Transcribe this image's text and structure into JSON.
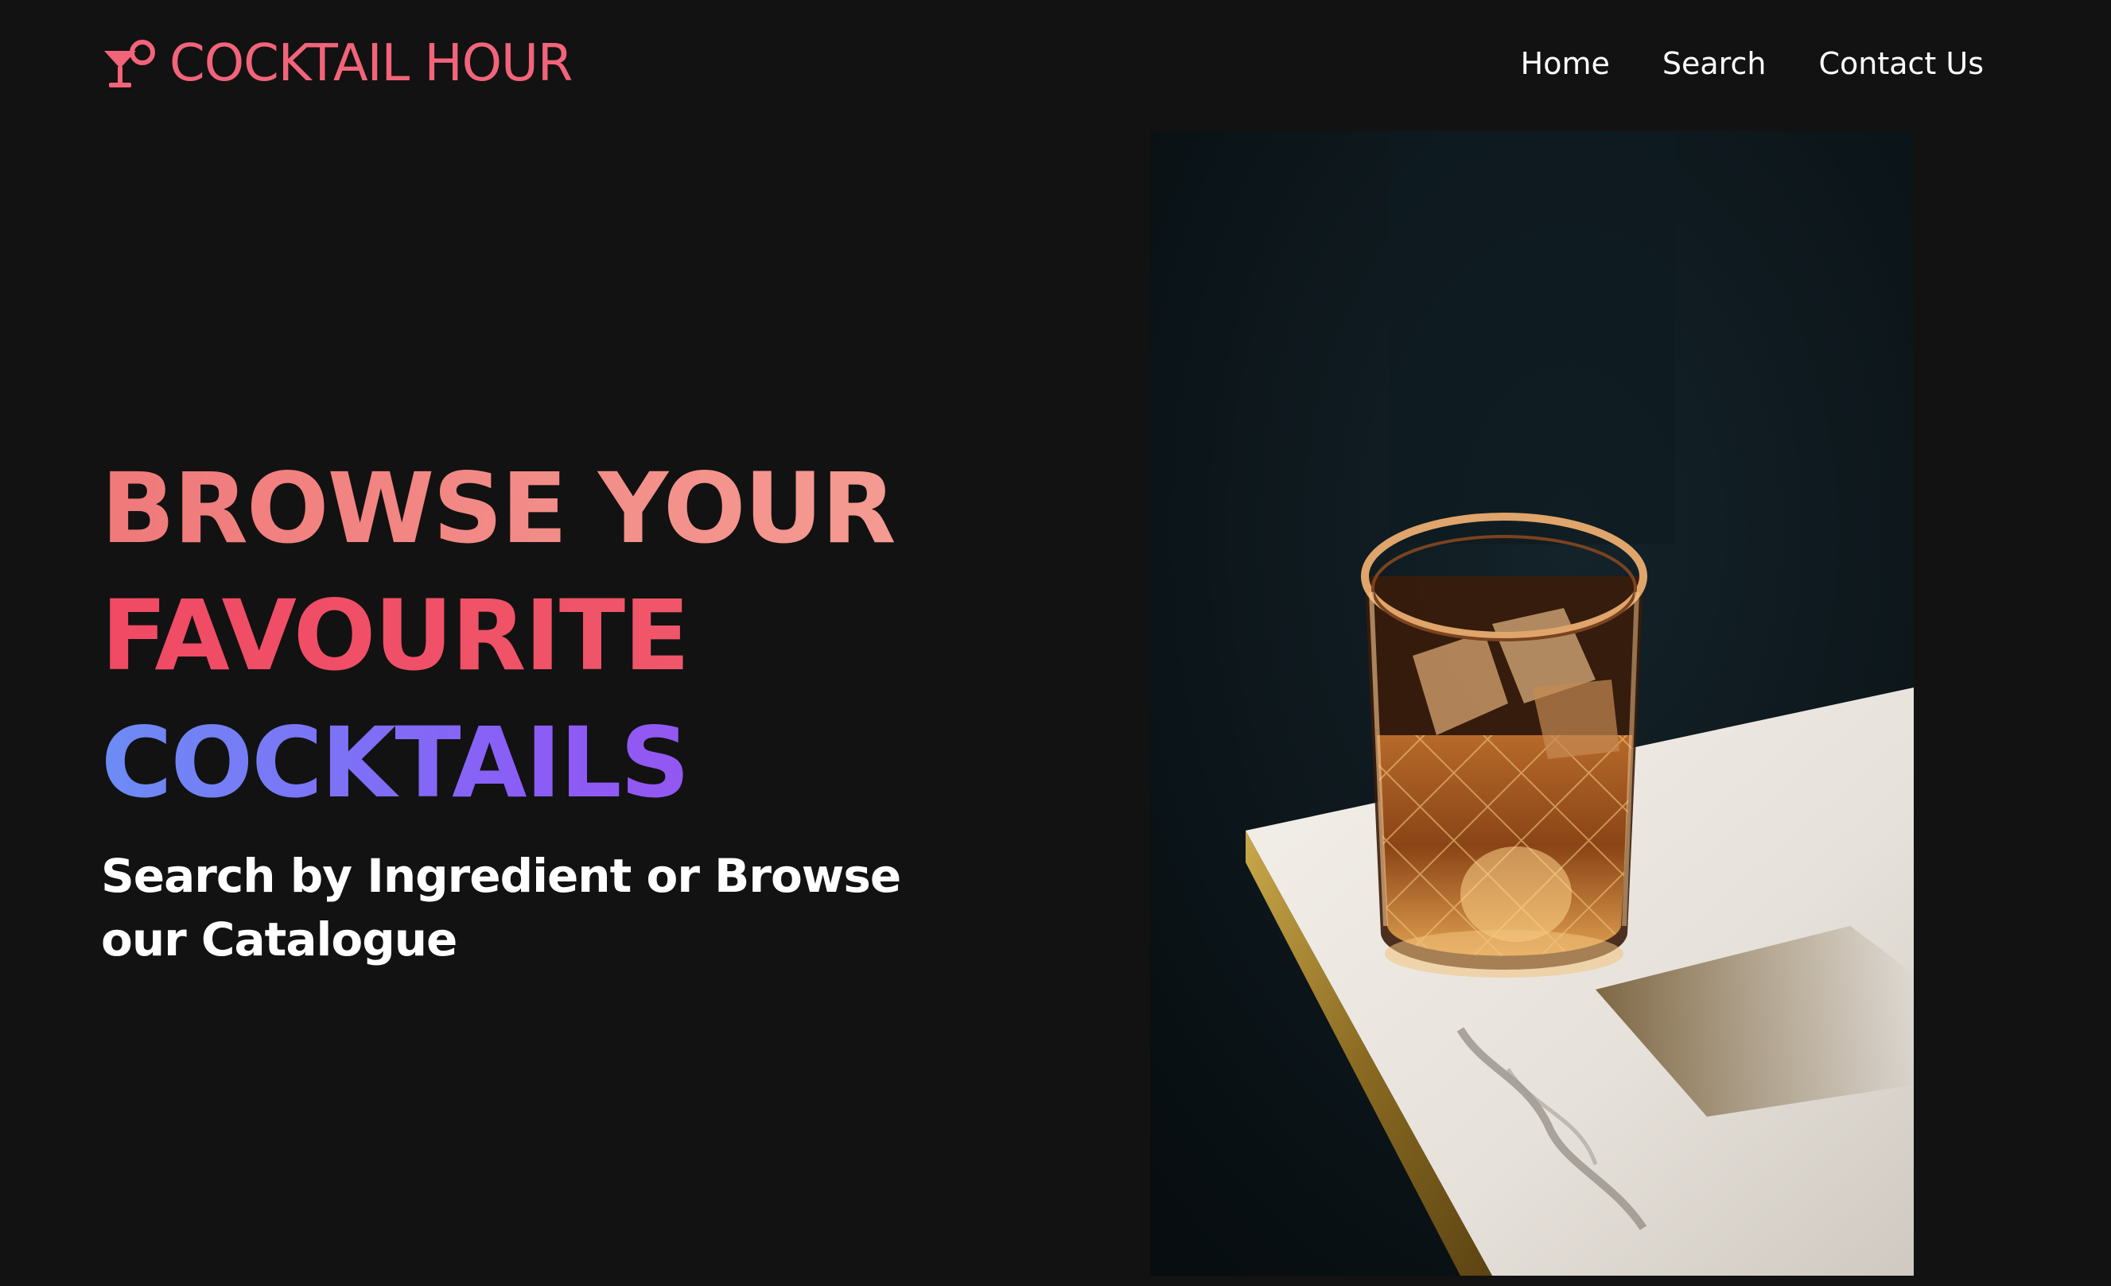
{
  "brand": {
    "name": "COCKTAIL HOUR",
    "icon": "cocktail-glass-icon",
    "color": "#f2647a"
  },
  "nav": {
    "items": [
      {
        "label": "Home"
      },
      {
        "label": "Search"
      },
      {
        "label": "Contact Us"
      }
    ]
  },
  "hero": {
    "title_lines": [
      "BROWSE YOUR",
      "FAVOURITE",
      "COCKTAILS"
    ],
    "subtitle": "Search by Ingredient or Browse our Catalogue",
    "image": "whiskey-glass-on-marble-table-photo"
  },
  "colors": {
    "background": "#121212",
    "title_line1": "#f28a86",
    "title_line2": "#f04d66",
    "title_line3": "#8b5cf6"
  }
}
